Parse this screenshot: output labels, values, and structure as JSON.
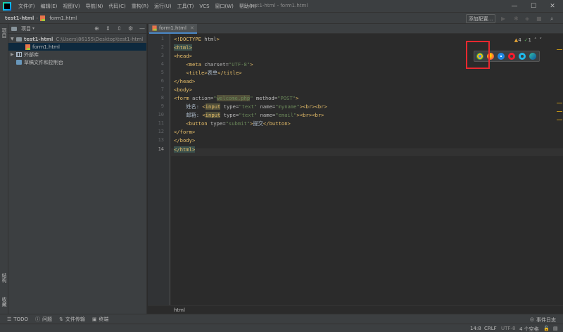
{
  "menubar": {
    "items": [
      "文件(F)",
      "编辑(E)",
      "视图(V)",
      "导航(N)",
      "代码(C)",
      "重构(R)",
      "运行(U)",
      "工具(T)",
      "VCS",
      "窗口(W)",
      "帮助(H)"
    ],
    "window_title": "test1-html - form1.html",
    "minimize": "—",
    "maximize": "☐",
    "close": "✕"
  },
  "navbar": {
    "project": "test1-html",
    "file": "form1.html",
    "add_config": "添加配置..."
  },
  "left_strip": {
    "project_tab": "项目",
    "structure_tab": "结构",
    "favorites_tab": "收藏"
  },
  "project_panel": {
    "title": "项目",
    "tree": {
      "root_name": "test1-html",
      "root_path": "C:\\Users\\86155\\Desktop\\test1-html",
      "file": "form1.html",
      "external_libs": "外部库",
      "scratches": "草稿文件和控制台"
    }
  },
  "editor": {
    "tab_label": "form1.html",
    "warnings": "4",
    "ok": "1",
    "line_numbers": [
      "1",
      "2",
      "3",
      "4",
      "5",
      "6",
      "7",
      "8",
      "9",
      "10",
      "11",
      "12",
      "13",
      "14"
    ],
    "breadcrumb": "html",
    "lines": {
      "l1_a": "<!DOCTYPE ",
      "l1_b": "html",
      "l1_c": ">",
      "l2": "<html>",
      "l3": "<head>",
      "l4_a": "<meta ",
      "l4_b": "charset=",
      "l4_c": "\"UTF-8\"",
      "l4_d": ">",
      "l5_a": "<title>",
      "l5_b": "表单",
      "l5_c": "</title>",
      "l6": "</head>",
      "l7": "<body>",
      "l8_a": "<form ",
      "l8_b": "action=",
      "l8_c": "\"",
      "l8_d": "welcome.php",
      "l8_e": "\"",
      "l8_f": " method=",
      "l8_g": "\"POST\"",
      "l8_h": ">",
      "l9_a": "姓名: ",
      "l9_b": "<",
      "l9_c": "input",
      "l9_d": " type=",
      "l9_e": "\"text\"",
      "l9_f": " name=",
      "l9_g": "\"myname\"",
      "l9_h": "><br><br>",
      "l10_a": "邮箱: ",
      "l10_b": "<",
      "l10_c": "input",
      "l10_d": " type=",
      "l10_e": "\"text\"",
      "l10_f": " name=",
      "l10_g": "\"email\"",
      "l10_h": "><br><br>",
      "l11_a": "<button ",
      "l11_b": "type=",
      "l11_c": "\"submit\"",
      "l11_d": ">",
      "l11_e": "提交",
      "l11_f": "</button>",
      "l12": "</form>",
      "l13": "</body>",
      "l14": "</html>"
    }
  },
  "bottom_bar": {
    "todo": "TODO",
    "problems": "问题",
    "file_transfer": "文件传输",
    "terminal": "终端",
    "event_log": "事件日志"
  },
  "statusbar": {
    "position": "14:8",
    "line_sep": "CRLF",
    "encoding": "UTF-8",
    "indent": "4 个空格"
  },
  "colors": {
    "highlight_box": "#e8282f",
    "tag": "#e8bf6a",
    "string": "#6a8759",
    "accent": "#4a88c7"
  },
  "browsers": [
    "chrome-icon",
    "firefox-icon",
    "safari-icon",
    "opera-icon",
    "ie-icon",
    "edge-icon"
  ]
}
